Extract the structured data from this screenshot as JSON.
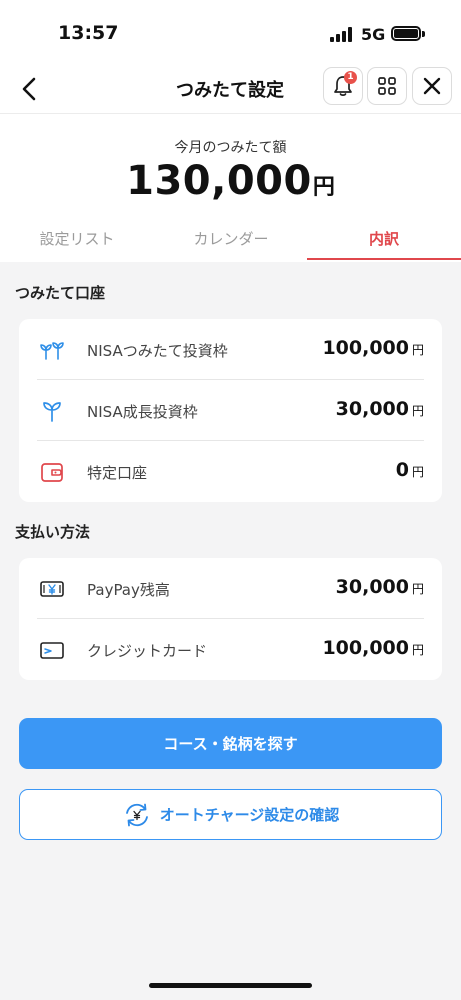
{
  "status_bar": {
    "time": "13:57",
    "network": "5G"
  },
  "nav": {
    "title": "つみたて設定",
    "notification_count": "1"
  },
  "summary": {
    "label": "今月のつみたて額",
    "amount": "130,000",
    "unit": "円"
  },
  "tabs": [
    {
      "label": "設定リスト",
      "active": false
    },
    {
      "label": "カレンダー",
      "active": false
    },
    {
      "label": "内訳",
      "active": true
    }
  ],
  "accounts": {
    "title": "つみたて口座",
    "items": [
      {
        "icon": "sprout-icon",
        "label": "NISAつみたて投資枠",
        "value": "100,000",
        "unit": "円"
      },
      {
        "icon": "seedling-icon",
        "label": "NISA成長投資枠",
        "value": "30,000",
        "unit": "円"
      },
      {
        "icon": "wallet-icon",
        "label": "特定口座",
        "value": "0",
        "unit": "円"
      }
    ]
  },
  "payments": {
    "title": "支払い方法",
    "items": [
      {
        "icon": "yen-cash-icon",
        "label": "PayPay残高",
        "value": "30,000",
        "unit": "円"
      },
      {
        "icon": "credit-card-icon",
        "label": "クレジットカード",
        "value": "100,000",
        "unit": "円"
      }
    ]
  },
  "buttons": {
    "find_course": "コース・銘柄を探す",
    "auto_charge": "オートチャージ設定の確認"
  },
  "colors": {
    "accent_red": "#e0474c",
    "primary_blue": "#3b97f5",
    "icon_blue": "#2f8fe8",
    "icon_red": "#e0474c",
    "background": "#f4f4f5"
  }
}
